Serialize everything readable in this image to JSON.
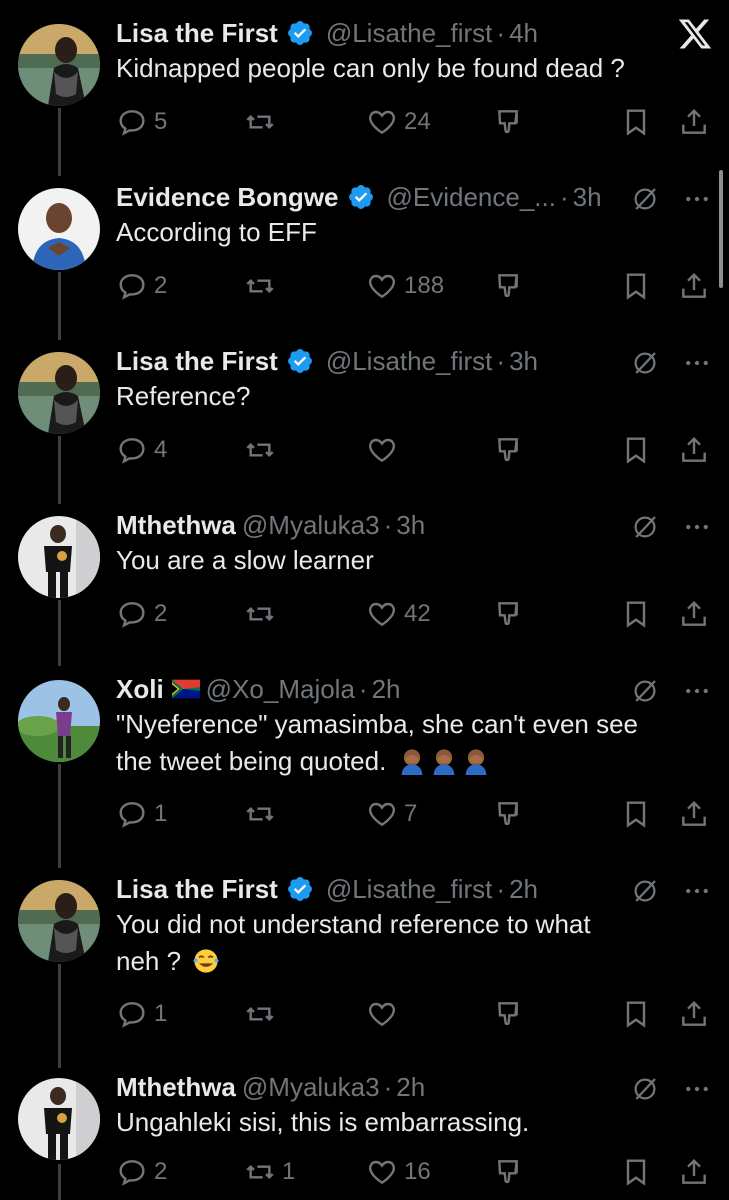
{
  "app": {
    "logo_icon": "x-logo-icon"
  },
  "colors": {
    "verified": "#1d9bf0",
    "text": "#e7e9ea",
    "muted": "#71767b",
    "background": "#000000"
  },
  "tweets": [
    {
      "name": "Lisa the First",
      "verified": true,
      "handle": "@Lisathe_first",
      "time": "4h",
      "text": "Kidnapped people can only be found dead ?",
      "replies": "5",
      "retweets": "",
      "likes": "24",
      "avatar": "lisa-avatar"
    },
    {
      "name": "Evidence Bongwe",
      "verified": true,
      "handle": "@Evidence_...",
      "time": "3h",
      "text": "According to EFF",
      "replies": "2",
      "retweets": "",
      "likes": "188",
      "avatar": "evidence-avatar"
    },
    {
      "name": "Lisa the First",
      "verified": true,
      "handle": "@Lisathe_first",
      "time": "3h",
      "text": "Reference?",
      "replies": "4",
      "retweets": "",
      "likes": "",
      "avatar": "lisa-avatar"
    },
    {
      "name": "Mthethwa",
      "verified": false,
      "handle": "@Myaluka3",
      "time": "3h",
      "text": "You are a slow learner",
      "replies": "2",
      "retweets": "",
      "likes": "42",
      "avatar": "mthethwa-avatar"
    },
    {
      "name": "Xoli",
      "verified": false,
      "flag": "south-africa-flag",
      "handle": "@Xo_Majola",
      "time": "2h",
      "text_line1": "\"Nyeference\" yamasimba, she can't even see",
      "text_line2": "the tweet being quoted.",
      "emoji": "face-palm-emoji",
      "replies": "1",
      "retweets": "",
      "likes": "7",
      "avatar": "xoli-avatar"
    },
    {
      "name": "Lisa the First",
      "verified": true,
      "handle": "@Lisathe_first",
      "time": "2h",
      "text_line1": "You did not understand reference to what",
      "text_line2": "neh ?",
      "emoji": "tears-of-joy-emoji",
      "replies": "1",
      "retweets": "",
      "likes": "",
      "avatar": "lisa-avatar"
    },
    {
      "name": "Mthethwa",
      "verified": false,
      "handle": "@Myaluka3",
      "time": "2h",
      "text": "Ungahleki sisi, this is embarrassing.",
      "replies": "2",
      "retweets": "1",
      "likes": "16",
      "avatar": "mthethwa-avatar"
    }
  ],
  "separator": "·"
}
